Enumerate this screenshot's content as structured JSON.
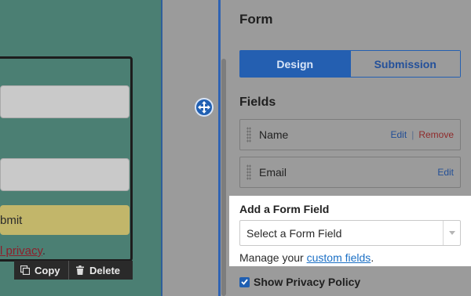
{
  "canvas": {
    "submit_label": "bmit",
    "privacy_link": "l privacy",
    "privacy_suffix": ".",
    "toolbar": {
      "copy_label": "Copy",
      "delete_label": "Delete"
    }
  },
  "panel": {
    "title": "Form",
    "tabs": [
      {
        "label": "Design",
        "active": true
      },
      {
        "label": "Submission",
        "active": false
      }
    ],
    "fields_title": "Fields",
    "fields": [
      {
        "label": "Name",
        "edit": "Edit",
        "separator": "|",
        "remove": "Remove"
      },
      {
        "label": "Email",
        "edit": "Edit"
      }
    ],
    "add_field": {
      "title": "Add a Form Field",
      "select_value": "Select a Form Field",
      "manage_prefix": "Manage your ",
      "manage_link": "custom fields",
      "manage_suffix": "."
    },
    "privacy_checkbox": {
      "label": "Show Privacy Policy",
      "checked": true
    }
  },
  "colors": {
    "canvas_bg": "#4b7f73",
    "accent": "#245fb1",
    "submit_bg": "#c2b66a",
    "link": "#1a6fc5",
    "remove": "#8f2a2a"
  }
}
